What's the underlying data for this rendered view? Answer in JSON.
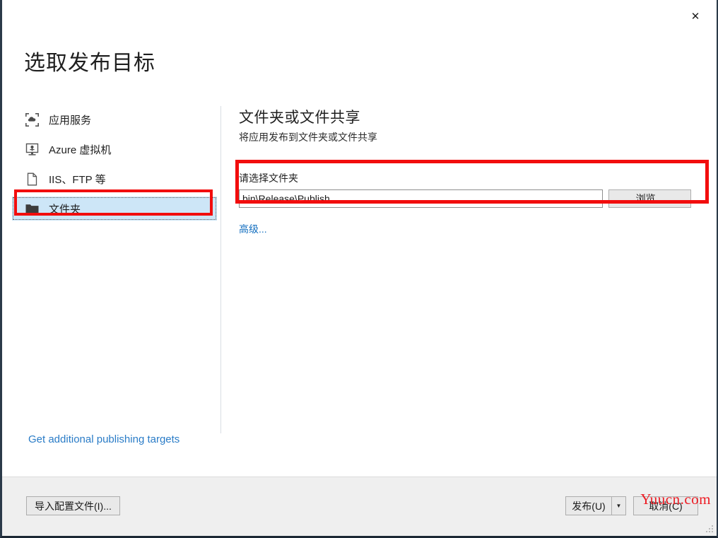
{
  "window": {
    "title": "选取发布目标",
    "close_label": "✕",
    "close_icon": "close-icon"
  },
  "sidebar": {
    "items": [
      {
        "label": "应用服务",
        "icon": "app-service-icon",
        "selected": false
      },
      {
        "label": "Azure 虚拟机",
        "icon": "azure-vm-icon",
        "selected": false
      },
      {
        "label": "IIS、FTP 等",
        "icon": "document-page-icon",
        "selected": false
      },
      {
        "label": "文件夹",
        "icon": "folder-icon",
        "selected": true
      }
    ],
    "footer_link": "Get additional publishing targets"
  },
  "content": {
    "heading": "文件夹或文件共享",
    "subheading": "将应用发布到文件夹或文件共享",
    "field_label": "请选择文件夹",
    "folder_value": "bin\\Release\\Publish",
    "folder_placeholder": "",
    "browse_label": "浏览...",
    "advanced_label": "高级..."
  },
  "footer": {
    "import_label": "导入配置文件(I)...",
    "publish_label": "发布(U)",
    "publish_dropdown_icon": "chevron-down-icon",
    "publish_dropdown_glyph": "▼",
    "cancel_label": "取消(C)"
  },
  "watermark": {
    "text": "Yuucn.com"
  },
  "colors": {
    "accent_link": "#2a7cc7",
    "advanced_link": "#1570c0",
    "annotation_red": "#f20d0d",
    "selection_blue": "#cde6f7",
    "footer_bg": "#efefef",
    "watermark_red": "#ed1c24",
    "window_border": "#2b3a49"
  }
}
